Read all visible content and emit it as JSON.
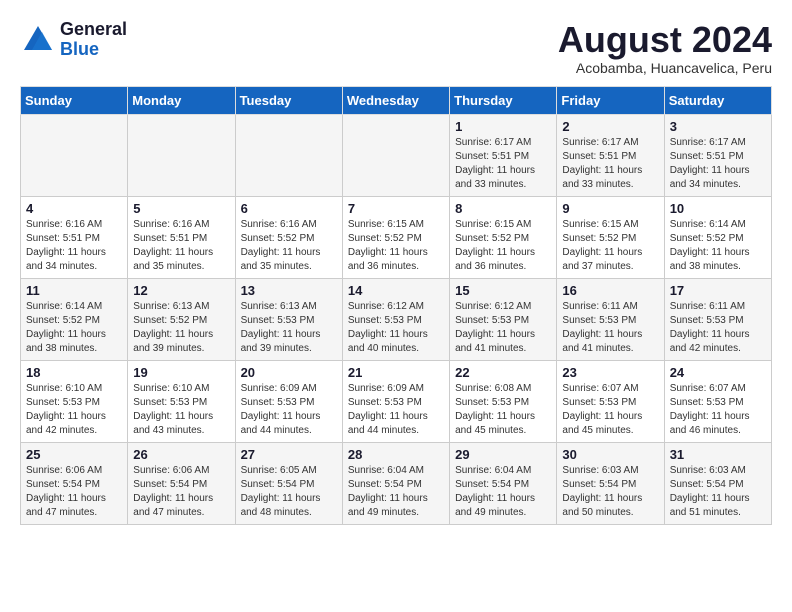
{
  "header": {
    "logo_line1": "General",
    "logo_line2": "Blue",
    "month_year": "August 2024",
    "location": "Acobamba, Huancavelica, Peru"
  },
  "weekdays": [
    "Sunday",
    "Monday",
    "Tuesday",
    "Wednesday",
    "Thursday",
    "Friday",
    "Saturday"
  ],
  "weeks": [
    [
      {
        "day": "",
        "info": ""
      },
      {
        "day": "",
        "info": ""
      },
      {
        "day": "",
        "info": ""
      },
      {
        "day": "",
        "info": ""
      },
      {
        "day": "1",
        "info": "Sunrise: 6:17 AM\nSunset: 5:51 PM\nDaylight: 11 hours\nand 33 minutes."
      },
      {
        "day": "2",
        "info": "Sunrise: 6:17 AM\nSunset: 5:51 PM\nDaylight: 11 hours\nand 33 minutes."
      },
      {
        "day": "3",
        "info": "Sunrise: 6:17 AM\nSunset: 5:51 PM\nDaylight: 11 hours\nand 34 minutes."
      }
    ],
    [
      {
        "day": "4",
        "info": "Sunrise: 6:16 AM\nSunset: 5:51 PM\nDaylight: 11 hours\nand 34 minutes."
      },
      {
        "day": "5",
        "info": "Sunrise: 6:16 AM\nSunset: 5:51 PM\nDaylight: 11 hours\nand 35 minutes."
      },
      {
        "day": "6",
        "info": "Sunrise: 6:16 AM\nSunset: 5:52 PM\nDaylight: 11 hours\nand 35 minutes."
      },
      {
        "day": "7",
        "info": "Sunrise: 6:15 AM\nSunset: 5:52 PM\nDaylight: 11 hours\nand 36 minutes."
      },
      {
        "day": "8",
        "info": "Sunrise: 6:15 AM\nSunset: 5:52 PM\nDaylight: 11 hours\nand 36 minutes."
      },
      {
        "day": "9",
        "info": "Sunrise: 6:15 AM\nSunset: 5:52 PM\nDaylight: 11 hours\nand 37 minutes."
      },
      {
        "day": "10",
        "info": "Sunrise: 6:14 AM\nSunset: 5:52 PM\nDaylight: 11 hours\nand 38 minutes."
      }
    ],
    [
      {
        "day": "11",
        "info": "Sunrise: 6:14 AM\nSunset: 5:52 PM\nDaylight: 11 hours\nand 38 minutes."
      },
      {
        "day": "12",
        "info": "Sunrise: 6:13 AM\nSunset: 5:52 PM\nDaylight: 11 hours\nand 39 minutes."
      },
      {
        "day": "13",
        "info": "Sunrise: 6:13 AM\nSunset: 5:53 PM\nDaylight: 11 hours\nand 39 minutes."
      },
      {
        "day": "14",
        "info": "Sunrise: 6:12 AM\nSunset: 5:53 PM\nDaylight: 11 hours\nand 40 minutes."
      },
      {
        "day": "15",
        "info": "Sunrise: 6:12 AM\nSunset: 5:53 PM\nDaylight: 11 hours\nand 41 minutes."
      },
      {
        "day": "16",
        "info": "Sunrise: 6:11 AM\nSunset: 5:53 PM\nDaylight: 11 hours\nand 41 minutes."
      },
      {
        "day": "17",
        "info": "Sunrise: 6:11 AM\nSunset: 5:53 PM\nDaylight: 11 hours\nand 42 minutes."
      }
    ],
    [
      {
        "day": "18",
        "info": "Sunrise: 6:10 AM\nSunset: 5:53 PM\nDaylight: 11 hours\nand 42 minutes."
      },
      {
        "day": "19",
        "info": "Sunrise: 6:10 AM\nSunset: 5:53 PM\nDaylight: 11 hours\nand 43 minutes."
      },
      {
        "day": "20",
        "info": "Sunrise: 6:09 AM\nSunset: 5:53 PM\nDaylight: 11 hours\nand 44 minutes."
      },
      {
        "day": "21",
        "info": "Sunrise: 6:09 AM\nSunset: 5:53 PM\nDaylight: 11 hours\nand 44 minutes."
      },
      {
        "day": "22",
        "info": "Sunrise: 6:08 AM\nSunset: 5:53 PM\nDaylight: 11 hours\nand 45 minutes."
      },
      {
        "day": "23",
        "info": "Sunrise: 6:07 AM\nSunset: 5:53 PM\nDaylight: 11 hours\nand 45 minutes."
      },
      {
        "day": "24",
        "info": "Sunrise: 6:07 AM\nSunset: 5:53 PM\nDaylight: 11 hours\nand 46 minutes."
      }
    ],
    [
      {
        "day": "25",
        "info": "Sunrise: 6:06 AM\nSunset: 5:54 PM\nDaylight: 11 hours\nand 47 minutes."
      },
      {
        "day": "26",
        "info": "Sunrise: 6:06 AM\nSunset: 5:54 PM\nDaylight: 11 hours\nand 47 minutes."
      },
      {
        "day": "27",
        "info": "Sunrise: 6:05 AM\nSunset: 5:54 PM\nDaylight: 11 hours\nand 48 minutes."
      },
      {
        "day": "28",
        "info": "Sunrise: 6:04 AM\nSunset: 5:54 PM\nDaylight: 11 hours\nand 49 minutes."
      },
      {
        "day": "29",
        "info": "Sunrise: 6:04 AM\nSunset: 5:54 PM\nDaylight: 11 hours\nand 49 minutes."
      },
      {
        "day": "30",
        "info": "Sunrise: 6:03 AM\nSunset: 5:54 PM\nDaylight: 11 hours\nand 50 minutes."
      },
      {
        "day": "31",
        "info": "Sunrise: 6:03 AM\nSunset: 5:54 PM\nDaylight: 11 hours\nand 51 minutes."
      }
    ]
  ]
}
